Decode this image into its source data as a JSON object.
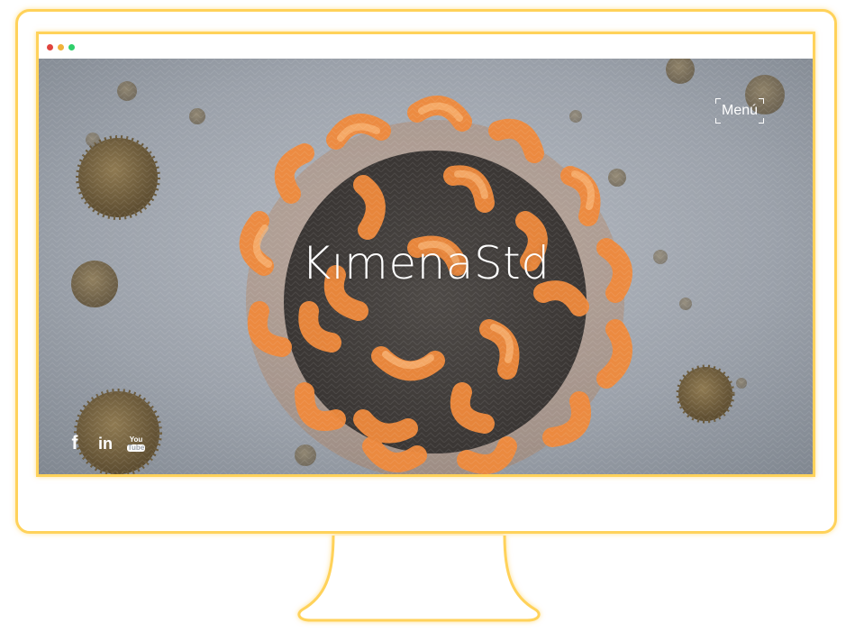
{
  "browser": {
    "dots": [
      "close",
      "minimize",
      "maximize"
    ]
  },
  "hero": {
    "brand": "KımenaStd",
    "menu_label": "Menú",
    "background": "orange virus particle illustration on grey textured backdrop"
  },
  "social": {
    "facebook_glyph": "f",
    "linkedin_glyph": "in",
    "youtube_top": "You",
    "youtube_bottom": "Tube"
  },
  "colors": {
    "frame": "#ffd25a",
    "accent_orange": "#f08a3c",
    "backdrop": "#9aa0a8"
  }
}
